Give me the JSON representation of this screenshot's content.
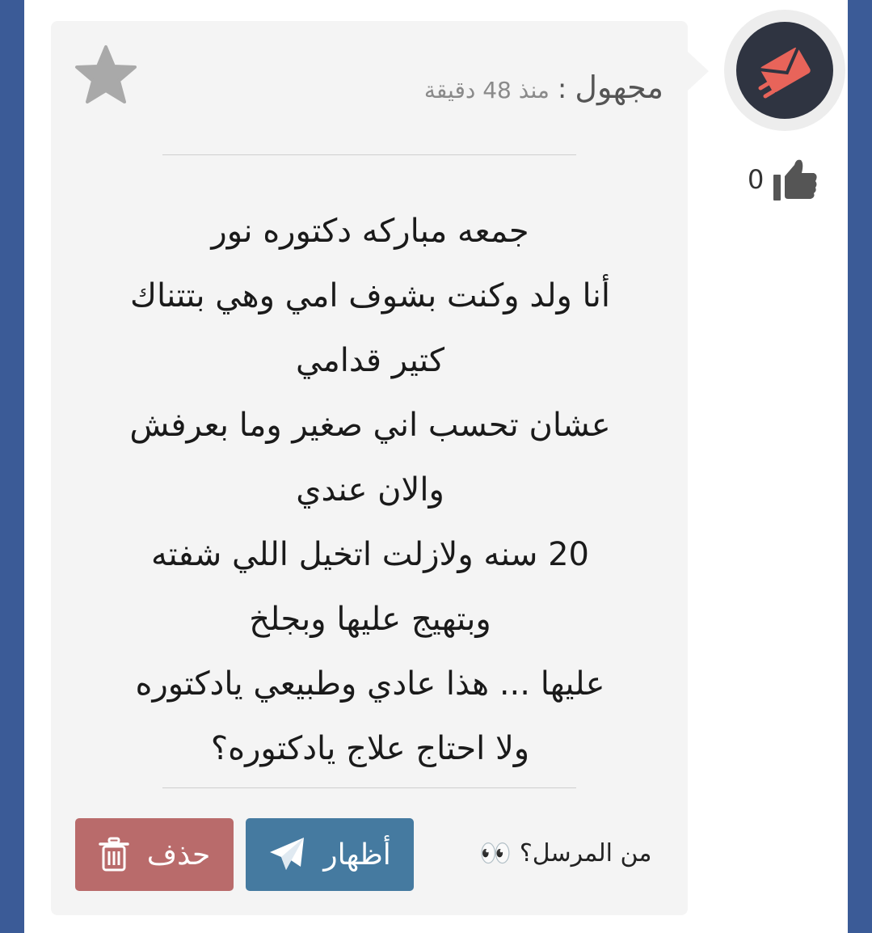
{
  "post": {
    "author": "مجهول",
    "separator": ":",
    "time": "منذ 48 دقيقة",
    "message_lines": [
      "جمعه مباركه دكتوره نور",
      "أنا ولد وكنت بشوف امي وهي بتتناك",
      "كتير قدامي",
      "عشان تحسب اني صغير وما بعرفش",
      "والان عندي",
      "20 سنه ولازلت اتخيل اللي شفته",
      "وبتهيج عليها وبجلخ",
      "عليها ... هذا عادي وطبيعي يادكتوره",
      "ولا احتاج علاج يادكتوره؟"
    ],
    "likes": "0",
    "sender_question": "من المرسل؟",
    "eyes_emoji": "👀",
    "show_button": "أظهار",
    "delete_button": "حذف"
  },
  "colors": {
    "frame": "#3b5b97",
    "card": "#f4f4f4",
    "show_button": "#457aa0",
    "delete_button": "#b96b6b",
    "avatar_bg": "#2f3441",
    "avatar_icon": "#e8645a"
  },
  "icons": {
    "favorite": "star-icon",
    "like": "thumbs-up-icon",
    "avatar": "envelope-send-icon",
    "show": "paper-plane-icon",
    "delete": "trash-icon"
  }
}
